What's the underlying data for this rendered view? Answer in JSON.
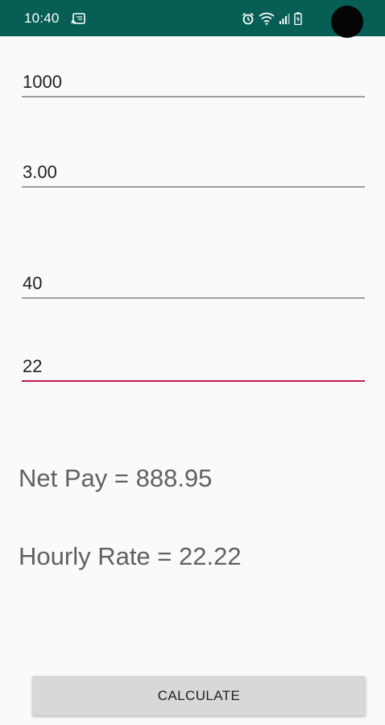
{
  "status_bar": {
    "time": "10:40",
    "background_color": "#075e54",
    "icons": [
      "cast-icon",
      "alarm-icon",
      "wifi-icon",
      "signal-icon",
      "battery-icon"
    ]
  },
  "form": {
    "fields": [
      {
        "value": "1000"
      },
      {
        "value": "3.00"
      },
      {
        "value": "40"
      },
      {
        "value": "22",
        "focused": true
      }
    ],
    "focus_color": "#c2185b"
  },
  "results": {
    "net_pay": "Net Pay = 888.95",
    "hourly_rate": "Hourly Rate = 22.22"
  },
  "actions": {
    "calculate_label": "CALCULATE"
  }
}
